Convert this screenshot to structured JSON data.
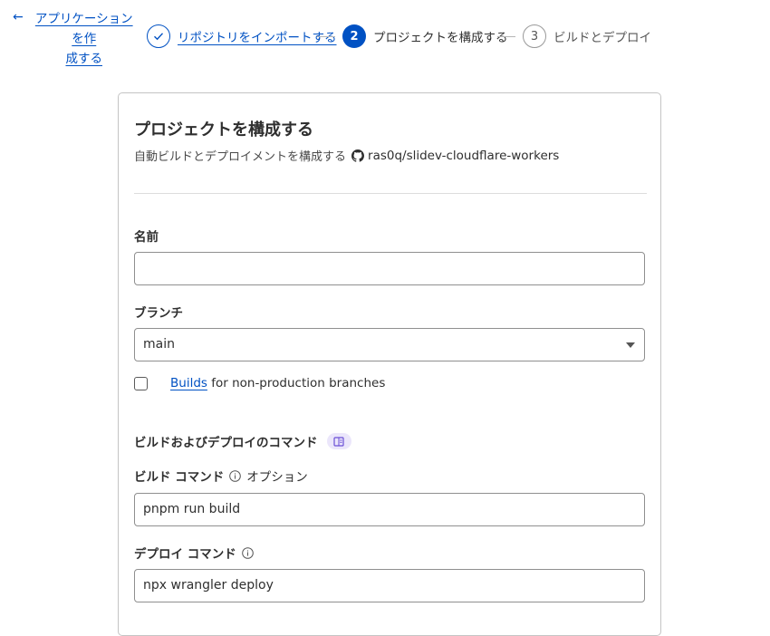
{
  "stepper": {
    "back_label": "アプリケーションを作成する",
    "back_line1": "アプリケーションを作",
    "back_line2": "成する",
    "steps": [
      {
        "number": "✓",
        "label": "リポジトリをインポートする",
        "state": "done"
      },
      {
        "number": "2",
        "label": "プロジェクトを構成する",
        "state": "active"
      },
      {
        "number": "3",
        "label": "ビルドとデプロイ",
        "state": "todo"
      }
    ]
  },
  "card": {
    "title": "プロジェクトを構成する",
    "subtitle": "自動ビルドとデプロイメントを構成する",
    "repo": "ras0q/slidev-cloudflare-workers",
    "name_label": "名前",
    "name_value": "",
    "branch_label": "ブランチ",
    "branch_value": "main",
    "builds_link": "Builds",
    "builds_text": " for non-production branches",
    "commands_heading": "ビルドおよびデプロイのコマンド",
    "build_cmd_label": "ビルド コマンド",
    "build_cmd_optional": "オプション",
    "build_cmd_value": "pnpm run build",
    "deploy_cmd_label": "デプロイ コマンド",
    "deploy_cmd_value": "npx wrangler deploy"
  },
  "colors": {
    "accent": "#0051c3",
    "badge_bg": "#ebe6fb",
    "badge_icon": "#6b4fd6"
  },
  "icons": {
    "back": "arrow-left-icon",
    "done": "check-icon",
    "repo": "github-icon",
    "docs": "book-icon",
    "info": "info-icon",
    "select": "caret-down-icon"
  }
}
